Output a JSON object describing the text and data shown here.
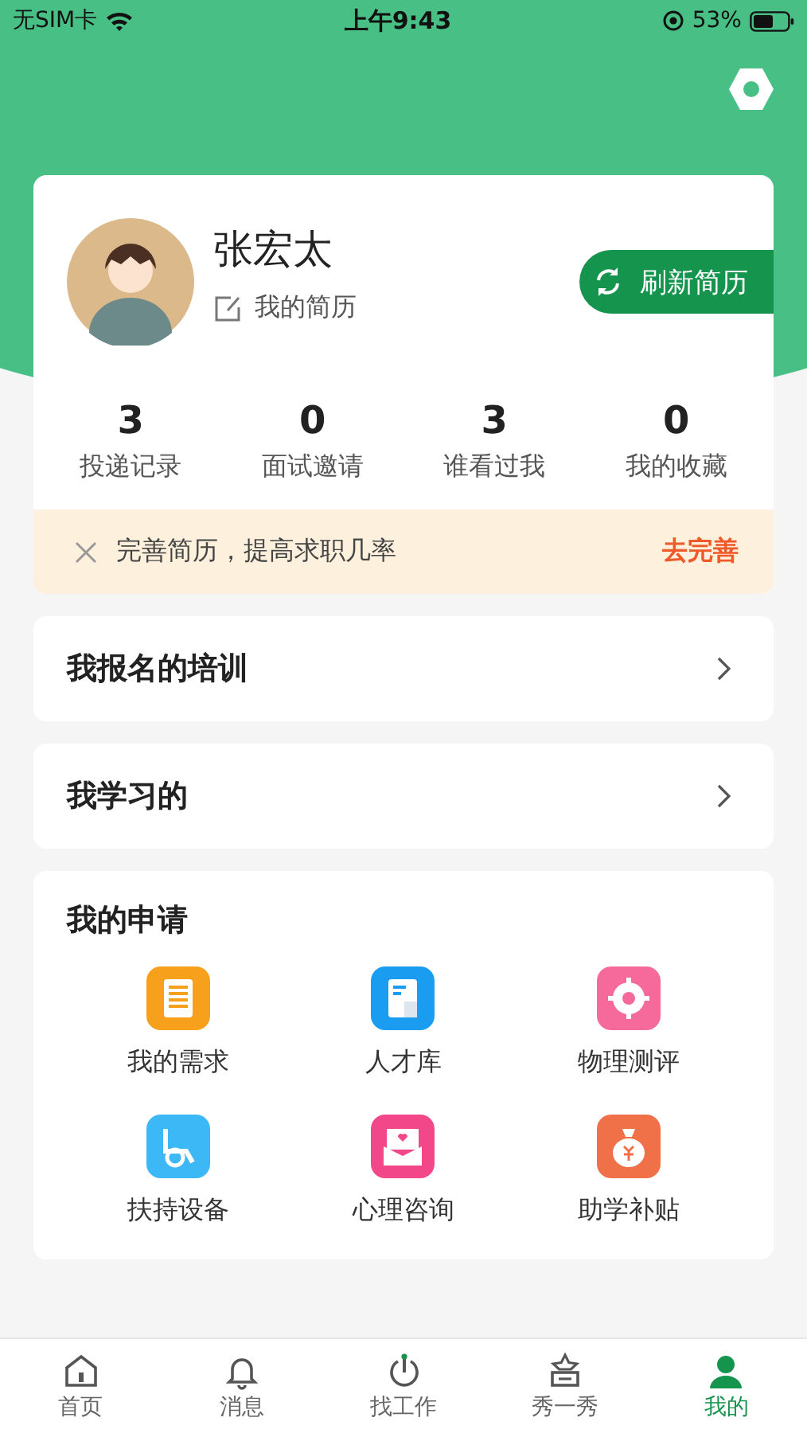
{
  "status_bar": {
    "carrier": "无SIM卡",
    "time": "上午9:43",
    "battery": "53%"
  },
  "profile": {
    "name": "张宏太",
    "resume_link": "我的简历",
    "refresh_button": "刷新简历"
  },
  "stats": [
    {
      "value": "3",
      "label": "投递记录"
    },
    {
      "value": "0",
      "label": "面试邀请"
    },
    {
      "value": "3",
      "label": "谁看过我"
    },
    {
      "value": "0",
      "label": "我的收藏"
    }
  ],
  "notice": {
    "text": "完善简历，提高求职几率",
    "action": "去完善"
  },
  "menu_rows": [
    {
      "label": "我报名的培训"
    },
    {
      "label": "我学习的"
    }
  ],
  "applications": {
    "title": "我的申请",
    "items": [
      {
        "label": "我的需求",
        "kind": "scroll",
        "color": "#f7a01c"
      },
      {
        "label": "人才库",
        "kind": "document",
        "color": "#1a9cf0"
      },
      {
        "label": "物理测评",
        "kind": "target",
        "color": "#f56a9a"
      },
      {
        "label": "扶持设备",
        "kind": "wheelchair",
        "color": "#3bb8f5"
      },
      {
        "label": "心理咨询",
        "kind": "heart",
        "color": "#f2488a"
      },
      {
        "label": "助学补贴",
        "kind": "moneybag",
        "color": "#f07048"
      }
    ]
  },
  "tabs": [
    {
      "label": "首页",
      "kind": "home",
      "selected": false
    },
    {
      "label": "消息",
      "kind": "bell",
      "selected": false
    },
    {
      "label": "找工作",
      "kind": "power",
      "selected": false
    },
    {
      "label": "秀一秀",
      "kind": "star",
      "selected": false
    },
    {
      "label": "我的",
      "kind": "person",
      "selected": true
    }
  ]
}
